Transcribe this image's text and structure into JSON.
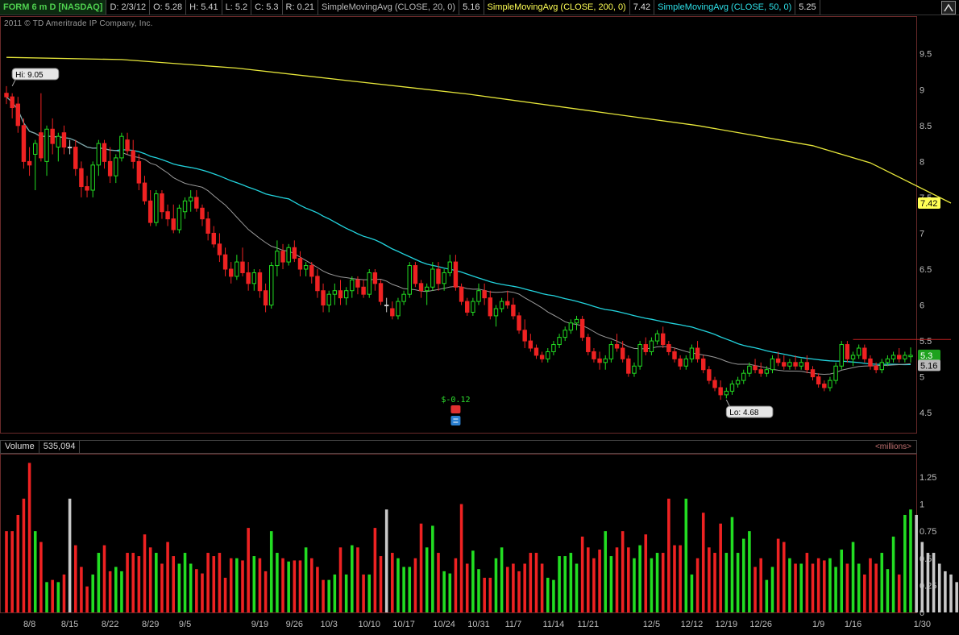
{
  "header": {
    "symbol": "FORM 6 m D [NASDAQ]",
    "date": "D: 2/3/12",
    "open": "O: 5.28",
    "high": "H: 5.41",
    "low": "L: 5.2",
    "close": "C: 5.3",
    "range": "R: 0.21",
    "sma20_label": "SimpleMovingAvg (CLOSE, 20, 0)",
    "sma20_value": "5.16",
    "sma200_label": "SimpleMovingAvg (CLOSE, 200, 0)",
    "sma200_value": "7.42",
    "sma50_label": "SimpleMovingAvg (CLOSE, 50, 0)",
    "sma50_value": "5.25"
  },
  "copyright": "2011 © TD Ameritrade IP Company, Inc.",
  "colors": {
    "up": "#22dd22",
    "down": "#ee2222",
    "neutral": "#c8c8c8",
    "sma20": "#9a9a9a",
    "sma50": "#22d3dd",
    "sma200": "#e6e63a"
  },
  "volume_header": {
    "label": "Volume",
    "value": "535,094",
    "units": "<millions>"
  },
  "chart_data": [
    {
      "type": "candlestick",
      "title": "FORM 6 m D [NASDAQ]",
      "ylim": [
        4.3,
        9.8
      ],
      "yticks": [
        4.5,
        5,
        5.5,
        6,
        6.5,
        7,
        7.5,
        8,
        8.5,
        9,
        9.5
      ],
      "ytick_labels": [
        "4.5",
        "5",
        "5.5",
        "6",
        "6.5",
        "7",
        "7.5",
        "8",
        "8.5",
        "9",
        "9.5"
      ],
      "x_labels": [
        {
          "i": 4,
          "t": "8/8"
        },
        {
          "i": 11,
          "t": "8/15"
        },
        {
          "i": 18,
          "t": "8/22"
        },
        {
          "i": 25,
          "t": "8/29"
        },
        {
          "i": 31,
          "t": "9/5"
        },
        {
          "i": 44,
          "t": "9/19"
        },
        {
          "i": 50,
          "t": "9/26"
        },
        {
          "i": 56,
          "t": "10/3"
        },
        {
          "i": 63,
          "t": "10/10"
        },
        {
          "i": 69,
          "t": "10/17"
        },
        {
          "i": 76,
          "t": "10/24"
        },
        {
          "i": 82,
          "t": "10/31"
        },
        {
          "i": 88,
          "t": "11/7"
        },
        {
          "i": 95,
          "t": "11/14"
        },
        {
          "i": 101,
          "t": "11/21"
        },
        {
          "i": 112,
          "t": "12/5"
        },
        {
          "i": 119,
          "t": "12/12"
        },
        {
          "i": 125,
          "t": "12/19"
        },
        {
          "i": 131,
          "t": "12/26"
        },
        {
          "i": 141,
          "t": "1/9"
        },
        {
          "i": 147,
          "t": "1/16"
        },
        {
          "i": 159,
          "t": "1/30"
        }
      ],
      "hi_label": {
        "text": "Hi: 9.05",
        "i": 1,
        "v": 9.05
      },
      "lo_label": {
        "text": "Lo: 4.68",
        "i": 125,
        "v": 4.68
      },
      "right_tags": [
        {
          "text": "7.42",
          "v": 7.42,
          "color": "#ffff55",
          "fg": "#000"
        },
        {
          "text": "5.3",
          "v": 5.3,
          "color": "#1ea21e",
          "fg": "#fff"
        },
        {
          "text": "5.16",
          "v": 5.16,
          "color": "#b8b8b8",
          "fg": "#000"
        }
      ],
      "event": {
        "text": "$-0.12",
        "i": 78
      },
      "sma200": [
        [
          0,
          9.45
        ],
        [
          20,
          9.42
        ],
        [
          40,
          9.3
        ],
        [
          60,
          9.12
        ],
        [
          80,
          8.94
        ],
        [
          100,
          8.72
        ],
        [
          120,
          8.5
        ],
        [
          140,
          8.22
        ],
        [
          150,
          7.98
        ],
        [
          164,
          7.42
        ]
      ],
      "candles": [
        [
          8.95,
          9.05,
          8.8,
          8.9
        ],
        [
          8.9,
          8.95,
          8.6,
          8.75
        ],
        [
          8.8,
          8.9,
          8.4,
          8.5
        ],
        [
          8.5,
          8.6,
          7.9,
          8.0
        ],
        [
          8.0,
          8.2,
          7.8,
          7.95
        ],
        [
          8.1,
          8.3,
          7.6,
          8.25
        ],
        [
          8.4,
          8.95,
          8.0,
          8.05
        ],
        [
          8.0,
          8.5,
          7.8,
          8.45
        ],
        [
          8.45,
          8.6,
          8.1,
          8.25
        ],
        [
          8.2,
          8.4,
          8.0,
          8.35
        ],
        [
          8.4,
          8.5,
          8.1,
          8.2
        ],
        [
          8.2,
          8.3,
          8.1,
          8.2
        ],
        [
          8.2,
          8.3,
          7.8,
          7.9
        ],
        [
          7.9,
          8.0,
          7.5,
          7.65
        ],
        [
          7.65,
          7.8,
          7.5,
          7.6
        ],
        [
          7.6,
          8.0,
          7.5,
          7.95
        ],
        [
          7.95,
          8.3,
          7.8,
          8.25
        ],
        [
          8.25,
          8.3,
          7.9,
          8.0
        ],
        [
          8.0,
          8.2,
          7.7,
          7.8
        ],
        [
          7.8,
          8.1,
          7.7,
          8.05
        ],
        [
          8.05,
          8.4,
          8.0,
          8.35
        ],
        [
          8.3,
          8.4,
          8.1,
          8.15
        ],
        [
          8.15,
          8.3,
          7.9,
          8.0
        ],
        [
          8.0,
          8.1,
          7.6,
          7.7
        ],
        [
          7.7,
          7.8,
          7.4,
          7.45
        ],
        [
          7.45,
          7.6,
          7.1,
          7.15
        ],
        [
          7.15,
          7.6,
          7.1,
          7.55
        ],
        [
          7.55,
          7.6,
          7.2,
          7.3
        ],
        [
          7.3,
          7.4,
          7.1,
          7.2
        ],
        [
          7.2,
          7.4,
          7.0,
          7.05
        ],
        [
          7.05,
          7.4,
          7.0,
          7.35
        ],
        [
          7.3,
          7.5,
          7.2,
          7.45
        ],
        [
          7.45,
          7.6,
          7.3,
          7.5
        ],
        [
          7.5,
          7.6,
          7.3,
          7.35
        ],
        [
          7.35,
          7.4,
          7.1,
          7.2
        ],
        [
          7.2,
          7.3,
          6.9,
          7.0
        ],
        [
          7.0,
          7.1,
          6.8,
          6.85
        ],
        [
          6.85,
          7.0,
          6.6,
          6.7
        ],
        [
          6.7,
          6.8,
          6.4,
          6.5
        ],
        [
          6.5,
          6.6,
          6.3,
          6.4
        ],
        [
          6.4,
          6.7,
          6.35,
          6.6
        ],
        [
          6.6,
          6.8,
          6.4,
          6.45
        ],
        [
          6.45,
          6.6,
          6.2,
          6.3
        ],
        [
          6.3,
          6.5,
          6.2,
          6.45
        ],
        [
          6.45,
          6.5,
          6.1,
          6.2
        ],
        [
          6.2,
          6.3,
          5.9,
          6.0
        ],
        [
          6.0,
          6.6,
          5.95,
          6.55
        ],
        [
          6.55,
          6.9,
          6.4,
          6.75
        ],
        [
          6.75,
          6.85,
          6.5,
          6.6
        ],
        [
          6.6,
          6.85,
          6.55,
          6.8
        ],
        [
          6.8,
          6.9,
          6.6,
          6.65
        ],
        [
          6.65,
          6.75,
          6.4,
          6.5
        ],
        [
          6.5,
          6.6,
          6.4,
          6.55
        ],
        [
          6.55,
          6.6,
          6.3,
          6.4
        ],
        [
          6.4,
          6.5,
          6.1,
          6.2
        ],
        [
          6.2,
          6.3,
          5.9,
          6.0
        ],
        [
          6.0,
          6.2,
          5.9,
          6.15
        ],
        [
          6.15,
          6.3,
          6.0,
          6.2
        ],
        [
          6.2,
          6.35,
          6.0,
          6.1
        ],
        [
          6.1,
          6.25,
          6.0,
          6.2
        ],
        [
          6.2,
          6.4,
          6.1,
          6.35
        ],
        [
          6.35,
          6.4,
          6.15,
          6.25
        ],
        [
          6.25,
          6.35,
          6.1,
          6.15
        ],
        [
          6.15,
          6.5,
          6.1,
          6.45
        ],
        [
          6.45,
          6.5,
          6.2,
          6.3
        ],
        [
          6.3,
          6.35,
          6.0,
          6.05
        ],
        [
          6.0,
          6.1,
          5.9,
          6.0
        ],
        [
          5.95,
          6.05,
          5.8,
          5.85
        ],
        [
          5.85,
          6.1,
          5.8,
          6.05
        ],
        [
          6.05,
          6.2,
          6.0,
          6.15
        ],
        [
          6.15,
          6.6,
          6.1,
          6.55
        ],
        [
          6.55,
          6.6,
          6.25,
          6.3
        ],
        [
          6.3,
          6.35,
          6.1,
          6.2
        ],
        [
          6.2,
          6.3,
          6.0,
          6.25
        ],
        [
          6.25,
          6.6,
          6.2,
          6.5
        ],
        [
          6.5,
          6.6,
          6.2,
          6.3
        ],
        [
          6.3,
          6.5,
          6.2,
          6.45
        ],
        [
          6.45,
          6.7,
          6.4,
          6.6
        ],
        [
          6.6,
          6.7,
          6.2,
          6.25
        ],
        [
          6.25,
          6.3,
          6.0,
          6.05
        ],
        [
          6.05,
          6.1,
          5.85,
          5.9
        ],
        [
          5.9,
          6.1,
          5.85,
          6.05
        ],
        [
          6.05,
          6.3,
          6.0,
          6.2
        ],
        [
          6.2,
          6.3,
          6.0,
          6.1
        ],
        [
          6.1,
          6.2,
          5.8,
          5.85
        ],
        [
          5.85,
          6.0,
          5.7,
          5.95
        ],
        [
          5.95,
          6.1,
          5.9,
          6.05
        ],
        [
          6.05,
          6.2,
          5.95,
          6.0
        ],
        [
          6.0,
          6.1,
          5.8,
          5.85
        ],
        [
          5.85,
          5.9,
          5.6,
          5.65
        ],
        [
          5.65,
          5.8,
          5.4,
          5.5
        ],
        [
          5.5,
          5.6,
          5.35,
          5.4
        ],
        [
          5.4,
          5.45,
          5.25,
          5.3
        ],
        [
          5.3,
          5.35,
          5.2,
          5.25
        ],
        [
          5.25,
          5.4,
          5.2,
          5.35
        ],
        [
          5.35,
          5.5,
          5.3,
          5.45
        ],
        [
          5.45,
          5.6,
          5.4,
          5.55
        ],
        [
          5.55,
          5.7,
          5.5,
          5.65
        ],
        [
          5.65,
          5.8,
          5.6,
          5.75
        ],
        [
          5.75,
          5.85,
          5.65,
          5.8
        ],
        [
          5.8,
          5.85,
          5.5,
          5.55
        ],
        [
          5.55,
          5.6,
          5.3,
          5.35
        ],
        [
          5.35,
          5.4,
          5.2,
          5.25
        ],
        [
          5.25,
          5.35,
          5.1,
          5.2
        ],
        [
          5.2,
          5.3,
          5.1,
          5.25
        ],
        [
          5.25,
          5.5,
          5.2,
          5.45
        ],
        [
          5.45,
          5.6,
          5.35,
          5.4
        ],
        [
          5.4,
          5.5,
          5.2,
          5.25
        ],
        [
          5.25,
          5.3,
          5.0,
          5.05
        ],
        [
          5.05,
          5.2,
          5.0,
          5.15
        ],
        [
          5.15,
          5.5,
          5.1,
          5.45
        ],
        [
          5.45,
          5.55,
          5.3,
          5.35
        ],
        [
          5.35,
          5.55,
          5.3,
          5.5
        ],
        [
          5.5,
          5.65,
          5.45,
          5.6
        ],
        [
          5.6,
          5.7,
          5.4,
          5.45
        ],
        [
          5.45,
          5.5,
          5.3,
          5.35
        ],
        [
          5.35,
          5.4,
          5.2,
          5.25
        ],
        [
          5.25,
          5.3,
          5.1,
          5.15
        ],
        [
          5.15,
          5.3,
          5.1,
          5.25
        ],
        [
          5.25,
          5.45,
          5.2,
          5.4
        ],
        [
          5.4,
          5.5,
          5.2,
          5.25
        ],
        [
          5.25,
          5.3,
          5.05,
          5.1
        ],
        [
          5.1,
          5.15,
          4.9,
          4.95
        ],
        [
          4.95,
          5.0,
          4.8,
          4.85
        ],
        [
          4.85,
          4.95,
          4.68,
          4.75
        ],
        [
          4.75,
          4.85,
          4.7,
          4.8
        ],
        [
          4.8,
          4.95,
          4.75,
          4.9
        ],
        [
          4.9,
          5.0,
          4.85,
          4.95
        ],
        [
          4.95,
          5.1,
          4.9,
          5.05
        ],
        [
          5.05,
          5.2,
          5.0,
          5.15
        ],
        [
          5.15,
          5.25,
          5.05,
          5.1
        ],
        [
          5.1,
          5.2,
          5.0,
          5.05
        ],
        [
          5.05,
          5.15,
          5.0,
          5.1
        ],
        [
          5.1,
          5.3,
          5.05,
          5.25
        ],
        [
          5.25,
          5.35,
          5.15,
          5.2
        ],
        [
          5.2,
          5.3,
          5.1,
          5.15
        ],
        [
          5.15,
          5.25,
          5.1,
          5.2
        ],
        [
          5.2,
          5.3,
          5.1,
          5.15
        ],
        [
          5.15,
          5.25,
          5.1,
          5.2
        ],
        [
          5.2,
          5.3,
          5.05,
          5.1
        ],
        [
          5.1,
          5.15,
          4.95,
          5.0
        ],
        [
          5.0,
          5.05,
          4.85,
          4.9
        ],
        [
          4.9,
          4.95,
          4.8,
          4.85
        ],
        [
          4.85,
          5.0,
          4.8,
          4.95
        ],
        [
          4.95,
          5.2,
          4.9,
          5.15
        ],
        [
          5.15,
          5.5,
          5.1,
          5.45
        ],
        [
          5.45,
          5.5,
          5.2,
          5.25
        ],
        [
          5.25,
          5.35,
          5.15,
          5.3
        ],
        [
          5.3,
          5.45,
          5.25,
          5.4
        ],
        [
          5.4,
          5.45,
          5.2,
          5.25
        ],
        [
          5.25,
          5.3,
          5.1,
          5.15
        ],
        [
          5.15,
          5.2,
          5.05,
          5.1
        ],
        [
          5.1,
          5.25,
          5.05,
          5.2
        ],
        [
          5.2,
          5.3,
          5.15,
          5.25
        ],
        [
          5.25,
          5.35,
          5.2,
          5.3
        ],
        [
          5.3,
          5.4,
          5.2,
          5.25
        ],
        [
          5.25,
          5.35,
          5.2,
          5.3
        ],
        [
          5.28,
          5.41,
          5.2,
          5.3
        ]
      ]
    },
    {
      "type": "bar",
      "title": "Volume",
      "ylabel": "<millions>",
      "ylim": [
        0,
        1.45
      ],
      "yticks": [
        0,
        0.25,
        0.5,
        0.75,
        1,
        1.25
      ],
      "ytick_labels": [
        "0",
        "0.25",
        "0.5",
        "0.75",
        "1",
        "1.25"
      ],
      "values": [
        0.75,
        0.75,
        0.9,
        1.05,
        1.38,
        0.75,
        0.65,
        0.28,
        0.3,
        0.28,
        0.35,
        1.05,
        0.62,
        0.42,
        0.24,
        0.35,
        0.55,
        0.62,
        0.38,
        0.42,
        0.38,
        0.55,
        0.55,
        0.52,
        0.72,
        0.6,
        0.55,
        0.45,
        0.65,
        0.52,
        0.45,
        0.55,
        0.45,
        0.4,
        0.36,
        0.55,
        0.52,
        0.55,
        0.32,
        0.5,
        0.5,
        0.48,
        0.78,
        0.52,
        0.5,
        0.38,
        0.75,
        0.55,
        0.5,
        0.47,
        0.48,
        0.48,
        0.6,
        0.5,
        0.42,
        0.3,
        0.3,
        0.35,
        0.6,
        0.35,
        0.62,
        0.6,
        0.35,
        0.35,
        0.78,
        0.52,
        0.95,
        0.55,
        0.5,
        0.42,
        0.42,
        0.5,
        0.82,
        0.6,
        0.8,
        0.55,
        0.38,
        0.36,
        0.5,
        1.0,
        0.45,
        0.57,
        0.4,
        0.32,
        0.32,
        0.5,
        0.6,
        0.42,
        0.45,
        0.38,
        0.45,
        0.55,
        0.55,
        0.45,
        0.32,
        0.3,
        0.52,
        0.52,
        0.55,
        0.45,
        0.7,
        0.6,
        0.5,
        0.58,
        0.75,
        0.52,
        0.6,
        0.75,
        0.6,
        0.5,
        0.62,
        0.72,
        0.5,
        0.55,
        0.55,
        1.05,
        0.62,
        0.62,
        1.05,
        0.35,
        0.5,
        0.92,
        0.6,
        0.55,
        0.82,
        0.55,
        0.88,
        0.55,
        0.68,
        0.75,
        0.42,
        0.5,
        0.3,
        0.42,
        0.68,
        0.65,
        0.5,
        0.45,
        0.45,
        0.55,
        0.45,
        0.5,
        0.48,
        0.5,
        0.42,
        0.58,
        0.45,
        0.65,
        0.45,
        0.35,
        0.5,
        0.45,
        0.55,
        0.4,
        0.7,
        0.35,
        0.9,
        0.95,
        0.9,
        0.65,
        0.55,
        0.55,
        0.45,
        0.38,
        0.35,
        0.28,
        0.25,
        0.3,
        0.38,
        0.45,
        0.55,
        0.58
      ]
    }
  ]
}
